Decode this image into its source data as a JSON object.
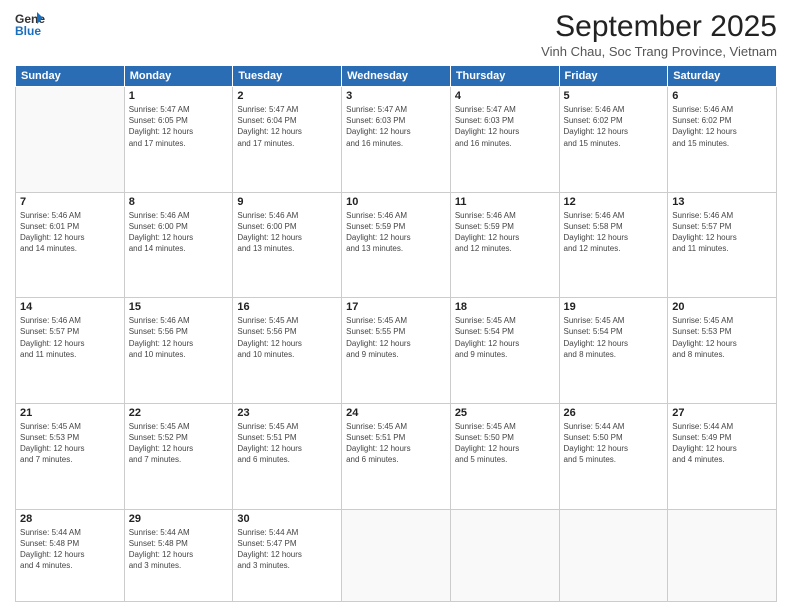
{
  "logo": {
    "line1": "General",
    "line2": "Blue"
  },
  "header": {
    "month": "September 2025",
    "location": "Vinh Chau, Soc Trang Province, Vietnam"
  },
  "weekdays": [
    "Sunday",
    "Monday",
    "Tuesday",
    "Wednesday",
    "Thursday",
    "Friday",
    "Saturday"
  ],
  "weeks": [
    [
      {
        "day": "",
        "info": ""
      },
      {
        "day": "1",
        "info": "Sunrise: 5:47 AM\nSunset: 6:05 PM\nDaylight: 12 hours\nand 17 minutes."
      },
      {
        "day": "2",
        "info": "Sunrise: 5:47 AM\nSunset: 6:04 PM\nDaylight: 12 hours\nand 17 minutes."
      },
      {
        "day": "3",
        "info": "Sunrise: 5:47 AM\nSunset: 6:03 PM\nDaylight: 12 hours\nand 16 minutes."
      },
      {
        "day": "4",
        "info": "Sunrise: 5:47 AM\nSunset: 6:03 PM\nDaylight: 12 hours\nand 16 minutes."
      },
      {
        "day": "5",
        "info": "Sunrise: 5:46 AM\nSunset: 6:02 PM\nDaylight: 12 hours\nand 15 minutes."
      },
      {
        "day": "6",
        "info": "Sunrise: 5:46 AM\nSunset: 6:02 PM\nDaylight: 12 hours\nand 15 minutes."
      }
    ],
    [
      {
        "day": "7",
        "info": "Sunrise: 5:46 AM\nSunset: 6:01 PM\nDaylight: 12 hours\nand 14 minutes."
      },
      {
        "day": "8",
        "info": "Sunrise: 5:46 AM\nSunset: 6:00 PM\nDaylight: 12 hours\nand 14 minutes."
      },
      {
        "day": "9",
        "info": "Sunrise: 5:46 AM\nSunset: 6:00 PM\nDaylight: 12 hours\nand 13 minutes."
      },
      {
        "day": "10",
        "info": "Sunrise: 5:46 AM\nSunset: 5:59 PM\nDaylight: 12 hours\nand 13 minutes."
      },
      {
        "day": "11",
        "info": "Sunrise: 5:46 AM\nSunset: 5:59 PM\nDaylight: 12 hours\nand 12 minutes."
      },
      {
        "day": "12",
        "info": "Sunrise: 5:46 AM\nSunset: 5:58 PM\nDaylight: 12 hours\nand 12 minutes."
      },
      {
        "day": "13",
        "info": "Sunrise: 5:46 AM\nSunset: 5:57 PM\nDaylight: 12 hours\nand 11 minutes."
      }
    ],
    [
      {
        "day": "14",
        "info": "Sunrise: 5:46 AM\nSunset: 5:57 PM\nDaylight: 12 hours\nand 11 minutes."
      },
      {
        "day": "15",
        "info": "Sunrise: 5:46 AM\nSunset: 5:56 PM\nDaylight: 12 hours\nand 10 minutes."
      },
      {
        "day": "16",
        "info": "Sunrise: 5:45 AM\nSunset: 5:56 PM\nDaylight: 12 hours\nand 10 minutes."
      },
      {
        "day": "17",
        "info": "Sunrise: 5:45 AM\nSunset: 5:55 PM\nDaylight: 12 hours\nand 9 minutes."
      },
      {
        "day": "18",
        "info": "Sunrise: 5:45 AM\nSunset: 5:54 PM\nDaylight: 12 hours\nand 9 minutes."
      },
      {
        "day": "19",
        "info": "Sunrise: 5:45 AM\nSunset: 5:54 PM\nDaylight: 12 hours\nand 8 minutes."
      },
      {
        "day": "20",
        "info": "Sunrise: 5:45 AM\nSunset: 5:53 PM\nDaylight: 12 hours\nand 8 minutes."
      }
    ],
    [
      {
        "day": "21",
        "info": "Sunrise: 5:45 AM\nSunset: 5:53 PM\nDaylight: 12 hours\nand 7 minutes."
      },
      {
        "day": "22",
        "info": "Sunrise: 5:45 AM\nSunset: 5:52 PM\nDaylight: 12 hours\nand 7 minutes."
      },
      {
        "day": "23",
        "info": "Sunrise: 5:45 AM\nSunset: 5:51 PM\nDaylight: 12 hours\nand 6 minutes."
      },
      {
        "day": "24",
        "info": "Sunrise: 5:45 AM\nSunset: 5:51 PM\nDaylight: 12 hours\nand 6 minutes."
      },
      {
        "day": "25",
        "info": "Sunrise: 5:45 AM\nSunset: 5:50 PM\nDaylight: 12 hours\nand 5 minutes."
      },
      {
        "day": "26",
        "info": "Sunrise: 5:44 AM\nSunset: 5:50 PM\nDaylight: 12 hours\nand 5 minutes."
      },
      {
        "day": "27",
        "info": "Sunrise: 5:44 AM\nSunset: 5:49 PM\nDaylight: 12 hours\nand 4 minutes."
      }
    ],
    [
      {
        "day": "28",
        "info": "Sunrise: 5:44 AM\nSunset: 5:48 PM\nDaylight: 12 hours\nand 4 minutes."
      },
      {
        "day": "29",
        "info": "Sunrise: 5:44 AM\nSunset: 5:48 PM\nDaylight: 12 hours\nand 3 minutes."
      },
      {
        "day": "30",
        "info": "Sunrise: 5:44 AM\nSunset: 5:47 PM\nDaylight: 12 hours\nand 3 minutes."
      },
      {
        "day": "",
        "info": ""
      },
      {
        "day": "",
        "info": ""
      },
      {
        "day": "",
        "info": ""
      },
      {
        "day": "",
        "info": ""
      }
    ]
  ]
}
